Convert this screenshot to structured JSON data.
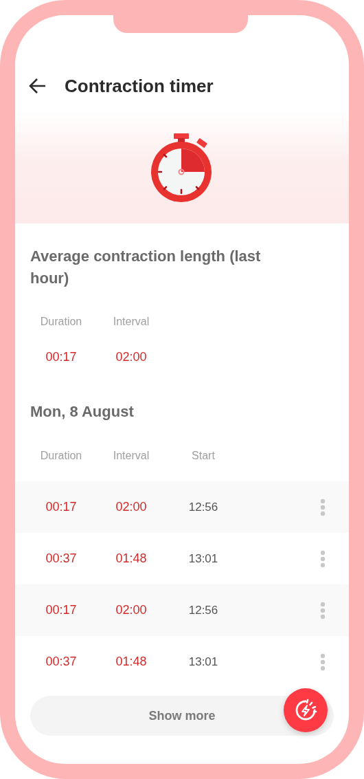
{
  "header": {
    "title": "Contraction timer"
  },
  "average": {
    "heading": "Average contraction length (last hour)",
    "columns": [
      "Duration",
      "Interval"
    ],
    "values": [
      "00:17",
      "02:00"
    ]
  },
  "day": {
    "heading": "Mon, 8 August",
    "columns": [
      "Duration",
      "Interval",
      "Start"
    ],
    "rows": [
      {
        "duration": "00:17",
        "interval": "02:00",
        "start": "12:56"
      },
      {
        "duration": "00:37",
        "interval": "01:48",
        "start": "13:01"
      },
      {
        "duration": "00:17",
        "interval": "02:00",
        "start": "12:56"
      },
      {
        "duration": "00:37",
        "interval": "01:48",
        "start": "13:01"
      }
    ]
  },
  "show_more": "Show more"
}
